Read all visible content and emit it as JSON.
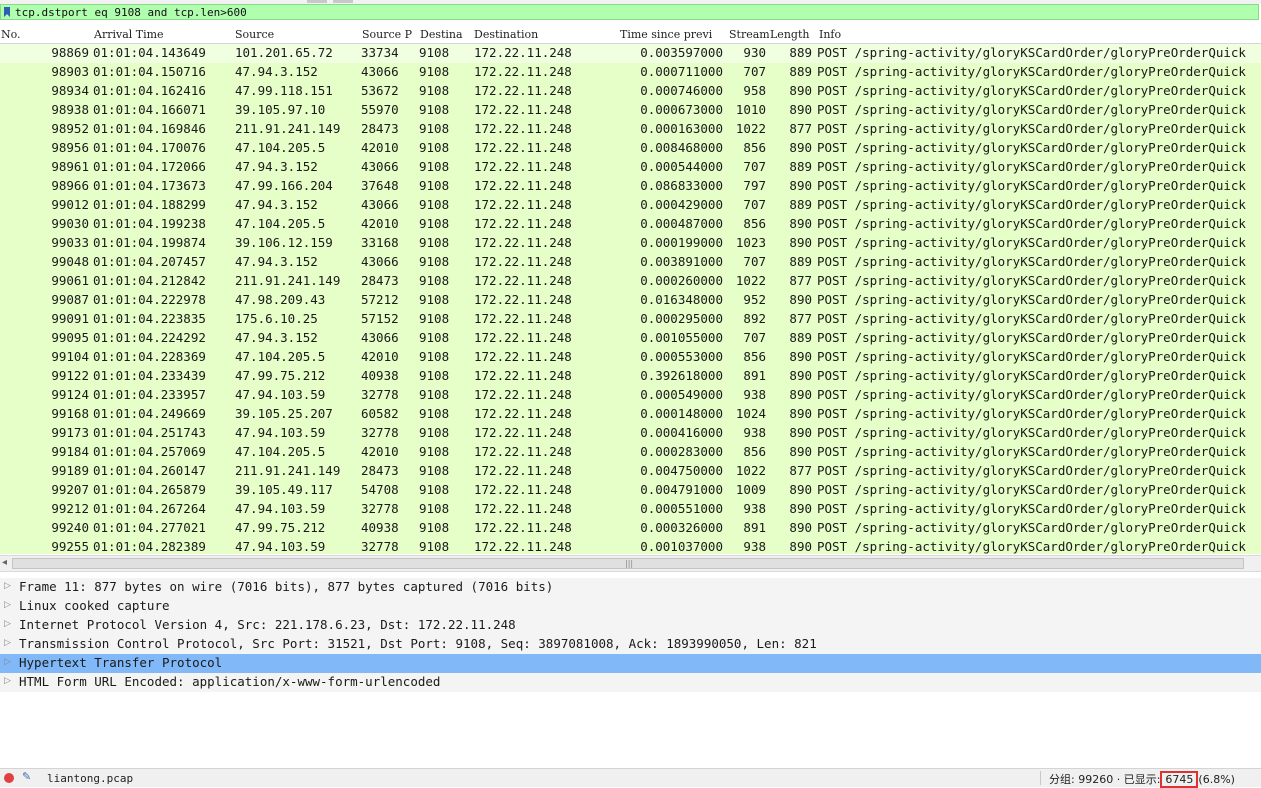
{
  "filter": {
    "value": "tcp.dstport eq 9108 and tcp.len>600"
  },
  "columns": {
    "no": "No.",
    "arrival": "Arrival Time",
    "source": "Source",
    "srcport": "Source P",
    "dstport": "Destina",
    "destination": "Destination",
    "delta": "Time since previ",
    "stream": "Stream",
    "length": "Length",
    "info": "Info"
  },
  "packets": [
    {
      "no": "98869",
      "arrival": "01:01:04.143649",
      "source": "101.201.65.72",
      "srcport": "33734",
      "dstport": "9108",
      "destination": "172.22.11.248",
      "delta": "0.003597000",
      "stream": "930",
      "length": "889",
      "info": "POST /spring-activity/gloryKSCardOrder/gloryPreOrderQuick"
    },
    {
      "no": "98903",
      "arrival": "01:01:04.150716",
      "source": "47.94.3.152",
      "srcport": "43066",
      "dstport": "9108",
      "destination": "172.22.11.248",
      "delta": "0.000711000",
      "stream": "707",
      "length": "889",
      "info": "POST /spring-activity/gloryKSCardOrder/gloryPreOrderQuick"
    },
    {
      "no": "98934",
      "arrival": "01:01:04.162416",
      "source": "47.99.118.151",
      "srcport": "53672",
      "dstport": "9108",
      "destination": "172.22.11.248",
      "delta": "0.000746000",
      "stream": "958",
      "length": "890",
      "info": "POST /spring-activity/gloryKSCardOrder/gloryPreOrderQuick"
    },
    {
      "no": "98938",
      "arrival": "01:01:04.166071",
      "source": "39.105.97.10",
      "srcport": "55970",
      "dstport": "9108",
      "destination": "172.22.11.248",
      "delta": "0.000673000",
      "stream": "1010",
      "length": "890",
      "info": "POST /spring-activity/gloryKSCardOrder/gloryPreOrderQuick"
    },
    {
      "no": "98952",
      "arrival": "01:01:04.169846",
      "source": "211.91.241.149",
      "srcport": "28473",
      "dstport": "9108",
      "destination": "172.22.11.248",
      "delta": "0.000163000",
      "stream": "1022",
      "length": "877",
      "info": "POST /spring-activity/gloryKSCardOrder/gloryPreOrderQuick"
    },
    {
      "no": "98956",
      "arrival": "01:01:04.170076",
      "source": "47.104.205.5",
      "srcport": "42010",
      "dstport": "9108",
      "destination": "172.22.11.248",
      "delta": "0.008468000",
      "stream": "856",
      "length": "890",
      "info": "POST /spring-activity/gloryKSCardOrder/gloryPreOrderQuick"
    },
    {
      "no": "98961",
      "arrival": "01:01:04.172066",
      "source": "47.94.3.152",
      "srcport": "43066",
      "dstport": "9108",
      "destination": "172.22.11.248",
      "delta": "0.000544000",
      "stream": "707",
      "length": "889",
      "info": "POST /spring-activity/gloryKSCardOrder/gloryPreOrderQuick"
    },
    {
      "no": "98966",
      "arrival": "01:01:04.173673",
      "source": "47.99.166.204",
      "srcport": "37648",
      "dstport": "9108",
      "destination": "172.22.11.248",
      "delta": "0.086833000",
      "stream": "797",
      "length": "890",
      "info": "POST /spring-activity/gloryKSCardOrder/gloryPreOrderQuick"
    },
    {
      "no": "99012",
      "arrival": "01:01:04.188299",
      "source": "47.94.3.152",
      "srcport": "43066",
      "dstport": "9108",
      "destination": "172.22.11.248",
      "delta": "0.000429000",
      "stream": "707",
      "length": "889",
      "info": "POST /spring-activity/gloryKSCardOrder/gloryPreOrderQuick"
    },
    {
      "no": "99030",
      "arrival": "01:01:04.199238",
      "source": "47.104.205.5",
      "srcport": "42010",
      "dstport": "9108",
      "destination": "172.22.11.248",
      "delta": "0.000487000",
      "stream": "856",
      "length": "890",
      "info": "POST /spring-activity/gloryKSCardOrder/gloryPreOrderQuick"
    },
    {
      "no": "99033",
      "arrival": "01:01:04.199874",
      "source": "39.106.12.159",
      "srcport": "33168",
      "dstport": "9108",
      "destination": "172.22.11.248",
      "delta": "0.000199000",
      "stream": "1023",
      "length": "890",
      "info": "POST /spring-activity/gloryKSCardOrder/gloryPreOrderQuick"
    },
    {
      "no": "99048",
      "arrival": "01:01:04.207457",
      "source": "47.94.3.152",
      "srcport": "43066",
      "dstport": "9108",
      "destination": "172.22.11.248",
      "delta": "0.003891000",
      "stream": "707",
      "length": "889",
      "info": "POST /spring-activity/gloryKSCardOrder/gloryPreOrderQuick"
    },
    {
      "no": "99061",
      "arrival": "01:01:04.212842",
      "source": "211.91.241.149",
      "srcport": "28473",
      "dstport": "9108",
      "destination": "172.22.11.248",
      "delta": "0.000260000",
      "stream": "1022",
      "length": "877",
      "info": "POST /spring-activity/gloryKSCardOrder/gloryPreOrderQuick"
    },
    {
      "no": "99087",
      "arrival": "01:01:04.222978",
      "source": "47.98.209.43",
      "srcport": "57212",
      "dstport": "9108",
      "destination": "172.22.11.248",
      "delta": "0.016348000",
      "stream": "952",
      "length": "890",
      "info": "POST /spring-activity/gloryKSCardOrder/gloryPreOrderQuick"
    },
    {
      "no": "99091",
      "arrival": "01:01:04.223835",
      "source": "175.6.10.25",
      "srcport": "57152",
      "dstport": "9108",
      "destination": "172.22.11.248",
      "delta": "0.000295000",
      "stream": "892",
      "length": "877",
      "info": "POST /spring-activity/gloryKSCardOrder/gloryPreOrderQuick"
    },
    {
      "no": "99095",
      "arrival": "01:01:04.224292",
      "source": "47.94.3.152",
      "srcport": "43066",
      "dstport": "9108",
      "destination": "172.22.11.248",
      "delta": "0.001055000",
      "stream": "707",
      "length": "889",
      "info": "POST /spring-activity/gloryKSCardOrder/gloryPreOrderQuick"
    },
    {
      "no": "99104",
      "arrival": "01:01:04.228369",
      "source": "47.104.205.5",
      "srcport": "42010",
      "dstport": "9108",
      "destination": "172.22.11.248",
      "delta": "0.000553000",
      "stream": "856",
      "length": "890",
      "info": "POST /spring-activity/gloryKSCardOrder/gloryPreOrderQuick"
    },
    {
      "no": "99122",
      "arrival": "01:01:04.233439",
      "source": "47.99.75.212",
      "srcport": "40938",
      "dstport": "9108",
      "destination": "172.22.11.248",
      "delta": "0.392618000",
      "stream": "891",
      "length": "890",
      "info": "POST /spring-activity/gloryKSCardOrder/gloryPreOrderQuick"
    },
    {
      "no": "99124",
      "arrival": "01:01:04.233957",
      "source": "47.94.103.59",
      "srcport": "32778",
      "dstport": "9108",
      "destination": "172.22.11.248",
      "delta": "0.000549000",
      "stream": "938",
      "length": "890",
      "info": "POST /spring-activity/gloryKSCardOrder/gloryPreOrderQuick"
    },
    {
      "no": "99168",
      "arrival": "01:01:04.249669",
      "source": "39.105.25.207",
      "srcport": "60582",
      "dstport": "9108",
      "destination": "172.22.11.248",
      "delta": "0.000148000",
      "stream": "1024",
      "length": "890",
      "info": "POST /spring-activity/gloryKSCardOrder/gloryPreOrderQuick"
    },
    {
      "no": "99173",
      "arrival": "01:01:04.251743",
      "source": "47.94.103.59",
      "srcport": "32778",
      "dstport": "9108",
      "destination": "172.22.11.248",
      "delta": "0.000416000",
      "stream": "938",
      "length": "890",
      "info": "POST /spring-activity/gloryKSCardOrder/gloryPreOrderQuick"
    },
    {
      "no": "99184",
      "arrival": "01:01:04.257069",
      "source": "47.104.205.5",
      "srcport": "42010",
      "dstport": "9108",
      "destination": "172.22.11.248",
      "delta": "0.000283000",
      "stream": "856",
      "length": "890",
      "info": "POST /spring-activity/gloryKSCardOrder/gloryPreOrderQuick"
    },
    {
      "no": "99189",
      "arrival": "01:01:04.260147",
      "source": "211.91.241.149",
      "srcport": "28473",
      "dstport": "9108",
      "destination": "172.22.11.248",
      "delta": "0.004750000",
      "stream": "1022",
      "length": "877",
      "info": "POST /spring-activity/gloryKSCardOrder/gloryPreOrderQuick"
    },
    {
      "no": "99207",
      "arrival": "01:01:04.265879",
      "source": "39.105.49.117",
      "srcport": "54708",
      "dstport": "9108",
      "destination": "172.22.11.248",
      "delta": "0.004791000",
      "stream": "1009",
      "length": "890",
      "info": "POST /spring-activity/gloryKSCardOrder/gloryPreOrderQuick"
    },
    {
      "no": "99212",
      "arrival": "01:01:04.267264",
      "source": "47.94.103.59",
      "srcport": "32778",
      "dstport": "9108",
      "destination": "172.22.11.248",
      "delta": "0.000551000",
      "stream": "938",
      "length": "890",
      "info": "POST /spring-activity/gloryKSCardOrder/gloryPreOrderQuick"
    },
    {
      "no": "99240",
      "arrival": "01:01:04.277021",
      "source": "47.99.75.212",
      "srcport": "40938",
      "dstport": "9108",
      "destination": "172.22.11.248",
      "delta": "0.000326000",
      "stream": "891",
      "length": "890",
      "info": "POST /spring-activity/gloryKSCardOrder/gloryPreOrderQuick"
    },
    {
      "no": "99255",
      "arrival": "01:01:04.282389",
      "source": "47.94.103.59",
      "srcport": "32778",
      "dstport": "9108",
      "destination": "172.22.11.248",
      "delta": "0.001037000",
      "stream": "938",
      "length": "890",
      "info": "POST /spring-activity/gloryKSCardOrder/gloryPreOrderQuick"
    }
  ],
  "details": [
    {
      "text": "Frame 11: 877 bytes on wire (7016 bits), 877 bytes captured (7016 bits)",
      "highlighted": false
    },
    {
      "text": "Linux cooked capture",
      "highlighted": false
    },
    {
      "text": "Internet Protocol Version 4, Src: 221.178.6.23, Dst: 172.22.11.248",
      "highlighted": false
    },
    {
      "text": "Transmission Control Protocol, Src Port: 31521, Dst Port: 9108, Seq: 3897081008, Ack: 1893990050, Len: 821",
      "highlighted": false
    },
    {
      "text": "Hypertext Transfer Protocol",
      "highlighted": true
    },
    {
      "text": "HTML Form URL Encoded: application/x-www-form-urlencoded",
      "highlighted": false
    }
  ],
  "status": {
    "filename": "liantong.pcap",
    "packets_label": "分组: 99260",
    "separator": "·",
    "displayed_label": "已显示:",
    "displayed_count": "6745",
    "displayed_pct": "(6.8%)"
  },
  "icons": {
    "bookmark": "bookmark-icon",
    "expand": "expand-triangle-icon",
    "capture": "capture-status-icon",
    "edit": "edit-comment-icon",
    "scroll_left": "scroll-left-arrow-icon",
    "grip": "scrollbar-grip-icon"
  },
  "colors": {
    "filter_bg": "#afffaf",
    "row_bg": "#e6ffc8",
    "highlight": "#80b8f8",
    "status_error": "#e04040",
    "outline": "#e03030"
  }
}
